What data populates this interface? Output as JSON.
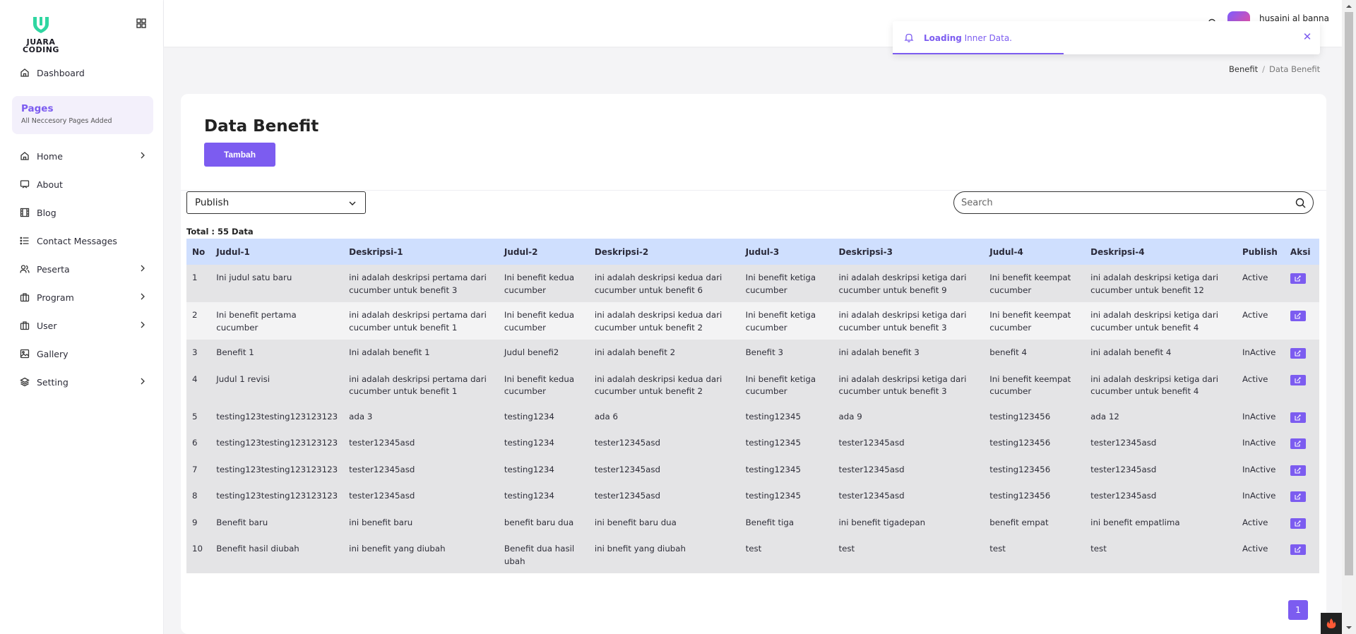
{
  "brand": {
    "logo_text_line1": "JUARA",
    "logo_text_line2": "CODING",
    "accent": "#7c5cf0"
  },
  "sidebar": {
    "dashboard_label": "Dashboard",
    "pages_title": "Pages",
    "pages_subtitle": "All Neccesory Pages Added",
    "items": [
      {
        "label": "Home",
        "icon": "home-icon",
        "has_submenu": true
      },
      {
        "label": "About",
        "icon": "about-icon",
        "has_submenu": false
      },
      {
        "label": "Blog",
        "icon": "blog-icon",
        "has_submenu": false
      },
      {
        "label": "Contact Messages",
        "icon": "list-icon",
        "has_submenu": false
      },
      {
        "label": "Peserta",
        "icon": "users-icon",
        "has_submenu": true
      },
      {
        "label": "Program",
        "icon": "briefcase-icon",
        "has_submenu": true
      },
      {
        "label": "User",
        "icon": "briefcase-icon",
        "has_submenu": true
      },
      {
        "label": "Gallery",
        "icon": "image-icon",
        "has_submenu": false
      },
      {
        "label": "Setting",
        "icon": "layers-icon",
        "has_submenu": true
      }
    ]
  },
  "topbar": {
    "user_name": "husaini al banna"
  },
  "toast": {
    "bold": "Loading",
    "text": " Inner Data.",
    "progress": 0.4
  },
  "breadcrumb": {
    "parent": "Benefit",
    "separator": "/",
    "current": "Data Benefit"
  },
  "main": {
    "title": "Data Benefit",
    "add_button": "Tambah",
    "filter_selected": "Publish",
    "search_placeholder": "Search",
    "total_label": "Total : 55 Data"
  },
  "table": {
    "headers": [
      "No",
      "Judul-1",
      "Deskripsi-1",
      "Judul-2",
      "Deskripsi-2",
      "Judul-3",
      "Deskripsi-3",
      "Judul-4",
      "Deskripsi-4",
      "Publish",
      "Aksi"
    ],
    "rows": [
      [
        "1",
        "Ini judul satu baru",
        "ini adalah deskripsi pertama dari cucumber untuk benefit 3",
        "Ini benefit kedua cucumber",
        "ini adalah deskripsi kedua dari cucumber untuk benefit 6",
        "Ini benefit ketiga cucumber",
        "ini adalah deskripsi ketiga dari cucumber untuk benefit 9",
        "Ini benefit keempat cucumber",
        "ini adalah deskripsi ketiga dari cucumber untuk benefit 12",
        "Active"
      ],
      [
        "2",
        "Ini benefit pertama cucumber",
        "ini adalah deskripsi pertama dari cucumber untuk benefit 1",
        "Ini benefit kedua cucumber",
        "ini adalah deskripsi kedua dari cucumber untuk benefit 2",
        "Ini benefit ketiga cucumber",
        "ini adalah deskripsi ketiga dari cucumber untuk benefit 3",
        "Ini benefit keempat cucumber",
        "ini adalah deskripsi ketiga dari cucumber untuk benefit 4",
        "Active"
      ],
      [
        "3",
        "Benefit 1",
        "Ini adalah benefit 1",
        "Judul benefi2",
        "ini adalah benefit 2",
        "Benefit 3",
        "ini adalah benefit 3",
        "benefit 4",
        "ini adalah benefit 4",
        "InActive"
      ],
      [
        "4",
        "Judul 1 revisi",
        "ini adalah deskripsi pertama dari cucumber untuk benefit 1",
        "Ini benefit kedua cucumber",
        "ini adalah deskripsi kedua dari cucumber untuk benefit 2",
        "Ini benefit ketiga cucumber",
        "ini adalah deskripsi ketiga dari cucumber untuk benefit 3",
        "Ini benefit keempat cucumber",
        "ini adalah deskripsi ketiga dari cucumber untuk benefit 4",
        "Active"
      ],
      [
        "5",
        "testing123testing123123123",
        "ada 3",
        "testing1234",
        "ada 6",
        "testing12345",
        "ada 9",
        "testing123456",
        "ada 12",
        "InActive"
      ],
      [
        "6",
        "testing123testing123123123",
        "tester12345asd",
        "testing1234",
        "tester12345asd",
        "testing12345",
        "tester12345asd",
        "testing123456",
        "tester12345asd",
        "InActive"
      ],
      [
        "7",
        "testing123testing123123123",
        "tester12345asd",
        "testing1234",
        "tester12345asd",
        "testing12345",
        "tester12345asd",
        "testing123456",
        "tester12345asd",
        "InActive"
      ],
      [
        "8",
        "testing123testing123123123",
        "tester12345asd",
        "testing1234",
        "tester12345asd",
        "testing12345",
        "tester12345asd",
        "testing123456",
        "tester12345asd",
        "InActive"
      ],
      [
        "9",
        "Benefit baru",
        "ini benefit baru",
        "benefit baru dua",
        "ini benefit baru dua",
        "Benefit tiga",
        "ini benefit tigadepan",
        "benefit empat",
        "ini benefit empatlima",
        "Active"
      ],
      [
        "10",
        "Benefit hasil diubah",
        "ini benefit yang diubah",
        "Benefit dua hasil ubah",
        "ini bnefit yang diubah",
        "test",
        "test",
        "test",
        "test",
        "Active"
      ]
    ]
  },
  "pagination": {
    "current_page": "1"
  }
}
